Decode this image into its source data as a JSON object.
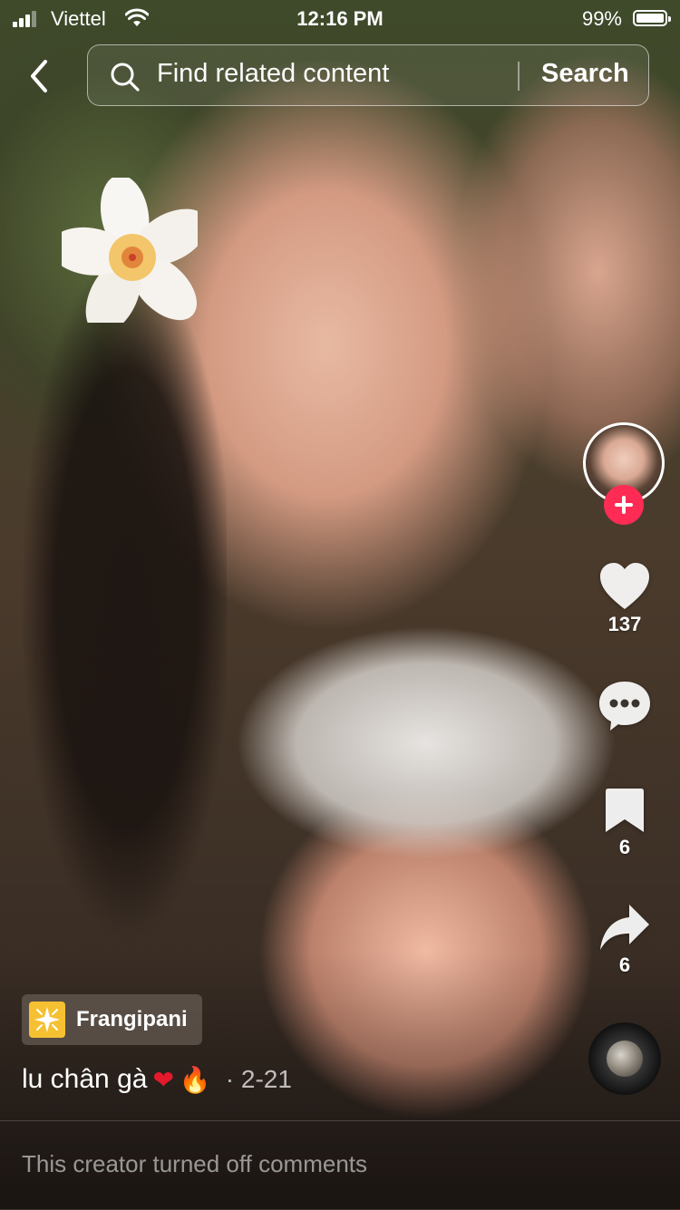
{
  "status_bar": {
    "carrier": "Viettel",
    "time": "12:16 PM",
    "battery_percent": "99%",
    "battery_level": 0.99
  },
  "search": {
    "placeholder": "Find related content",
    "button_label": "Search"
  },
  "rail": {
    "likes": "137",
    "saves": "6",
    "shares": "6"
  },
  "effect": {
    "name": "Frangipani"
  },
  "video": {
    "caption": "lu chân gà",
    "emoji_1": "❤",
    "emoji_2": "🔥",
    "date": "· 2-21"
  },
  "comments": {
    "status": "This creator turned off comments"
  },
  "colors": {
    "follow_badge": "#fe2c55",
    "effect_icon": "#f5c132"
  }
}
